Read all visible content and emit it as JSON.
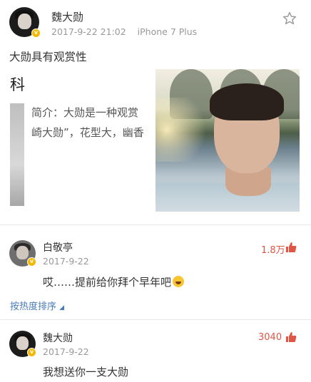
{
  "post": {
    "author": "魏大勋",
    "timestamp": "2017-9-22 21:02",
    "device": "iPhone 7 Plus",
    "text": "大勋具有观赏性",
    "image_left": {
      "title_fragment": "科",
      "line1": "简介：大勋是一种观赏",
      "line2": "崎大勋”，花型大，幽香"
    }
  },
  "comments": [
    {
      "author": "白敬亭",
      "date": "2017-9-22",
      "text": "哎……提前给你拜个早年吧",
      "likes": "1.8万"
    },
    {
      "author": "魏大勋",
      "date": "2017-9-22",
      "text": "我想送你一支大勋",
      "likes": "3040"
    }
  ],
  "sort_label": "按热度排序",
  "colors": {
    "like": "#e05543",
    "link": "#4a7bb7",
    "verified": "#f5b800"
  },
  "icons": {
    "favorite": "star-outline-icon",
    "like": "thumbs-up-icon",
    "verified": "verified-badge-icon",
    "sort": "caret-icon",
    "emoji": "laughing-tears-emoji"
  }
}
